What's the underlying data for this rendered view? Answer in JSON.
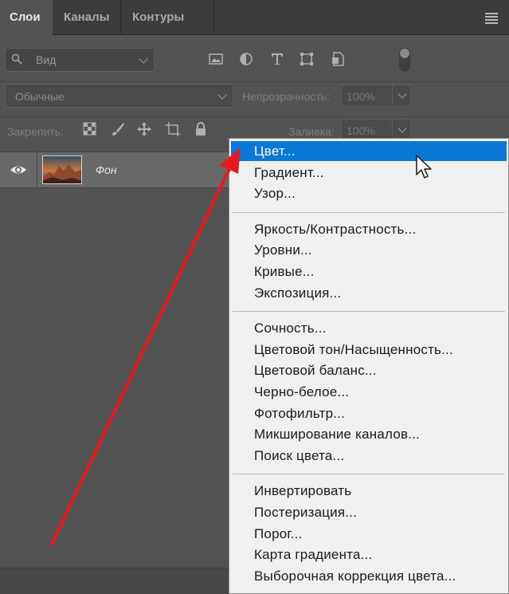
{
  "tabs": [
    {
      "label": "Слои",
      "active": true
    },
    {
      "label": "Каналы",
      "active": false
    },
    {
      "label": "Контуры",
      "active": false
    }
  ],
  "filter": {
    "value": "Вид"
  },
  "filter_icons": [
    "image-filter-icon",
    "adjustment-filter-icon",
    "type-filter-icon",
    "shape-filter-icon",
    "smart-object-filter-icon"
  ],
  "blend_mode": {
    "value": "Обычные"
  },
  "opacity": {
    "label": "Непрозрачность:",
    "value": "100%"
  },
  "lock": {
    "label": "Закрепить:",
    "icons": [
      "lock-transparent-icon",
      "lock-brush-icon",
      "lock-move-icon",
      "lock-artboard-icon",
      "lock-all-icon"
    ]
  },
  "fill": {
    "label": "Заливка:",
    "value": "100%"
  },
  "layer": {
    "name": "Фон",
    "visible": true
  },
  "menu": {
    "highlighted_index": 0,
    "groups": [
      [
        "Цвет...",
        "Градиент...",
        "Узор..."
      ],
      [
        "Яркость/Контрастность...",
        "Уровни...",
        "Кривые...",
        "Экспозиция..."
      ],
      [
        "Сочность...",
        "Цветовой тон/Насыщенность...",
        "Цветовой баланс...",
        "Черно-белое...",
        "Фотофильтр...",
        "Микширование каналов...",
        "Поиск цвета..."
      ],
      [
        "Инвертировать",
        "Постеризация...",
        "Порог...",
        "Карта градиента...",
        "Выборочная коррекция цвета..."
      ]
    ]
  },
  "colors": {
    "panel": "#535353",
    "highlight": "#0a78d7",
    "arrow": "#e8191a",
    "menu_bg": "#f0f0f0"
  }
}
